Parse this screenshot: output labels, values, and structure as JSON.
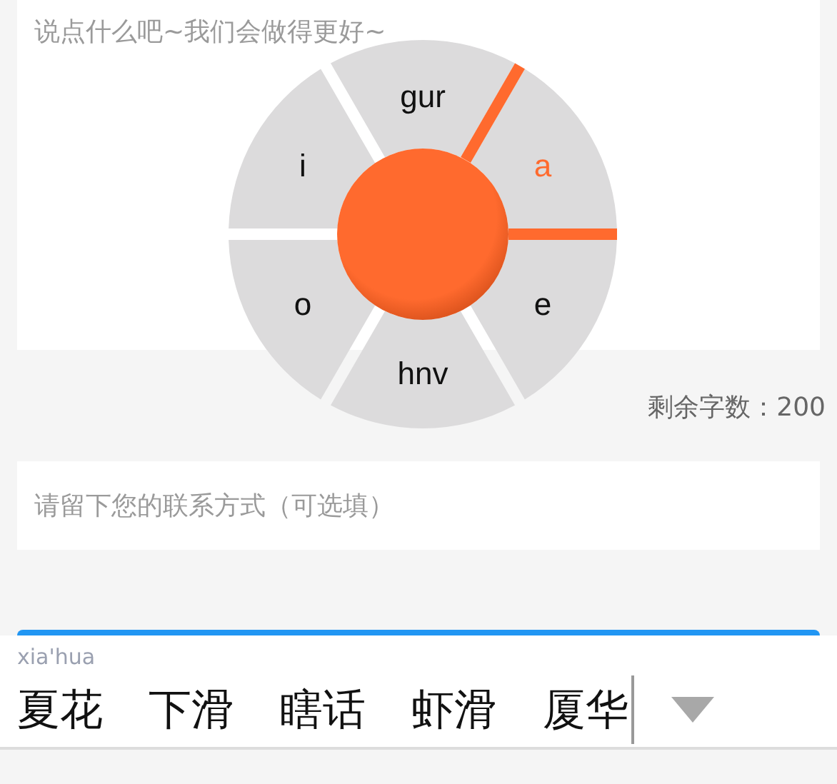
{
  "feedback_field": {
    "placeholder": "说点什么吧~我们会做得更好~"
  },
  "swipe_wheel": {
    "sectors": [
      {
        "label": "gur",
        "selected": false
      },
      {
        "label": "a",
        "selected": true
      },
      {
        "label": "e",
        "selected": false
      },
      {
        "label": "hnv",
        "selected": false
      },
      {
        "label": "o",
        "selected": false
      },
      {
        "label": "i",
        "selected": false
      }
    ]
  },
  "char_count": "剩余字数：200",
  "contact_field": {
    "placeholder": "请留下您的联系方式（可选填）"
  },
  "ime": {
    "composition": "xia'hua",
    "candidates": [
      "夏花",
      "下滑",
      "瞎话",
      "虾滑",
      "厦华"
    ]
  }
}
